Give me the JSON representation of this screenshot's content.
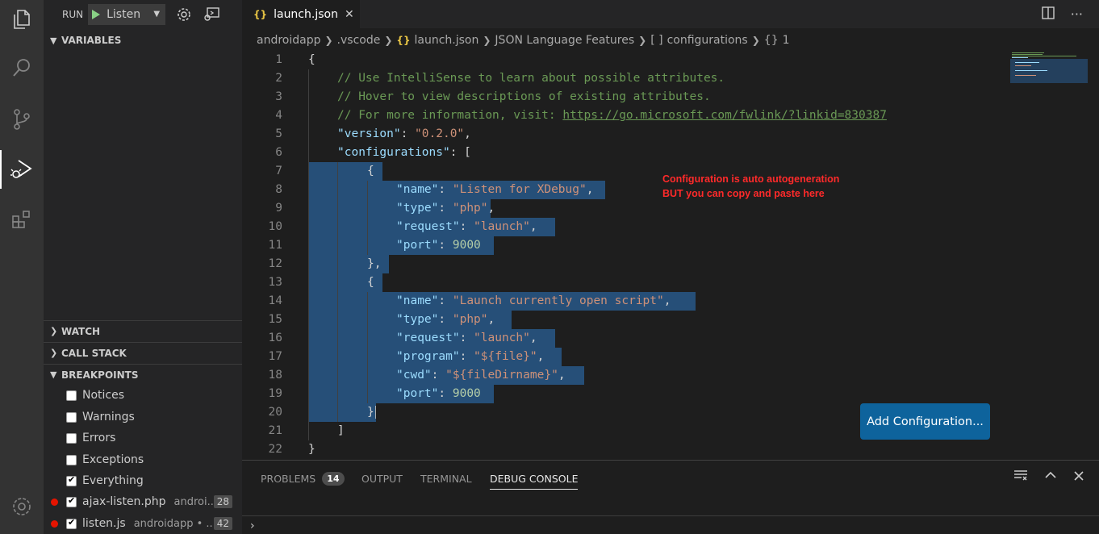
{
  "sidebar": {
    "run_label": "RUN",
    "config_name": "Listen",
    "sections": {
      "variables": "VARIABLES",
      "watch": "WATCH",
      "call_stack": "CALL STACK",
      "breakpoints": "BREAKPOINTS"
    },
    "breakpoints": [
      {
        "label": "Notices",
        "checked": false
      },
      {
        "label": "Warnings",
        "checked": false
      },
      {
        "label": "Errors",
        "checked": false
      },
      {
        "label": "Exceptions",
        "checked": false
      },
      {
        "label": "Everything",
        "checked": true
      }
    ],
    "files": [
      {
        "name": "ajax-listen.php",
        "path": "androi...",
        "line": "28"
      },
      {
        "name": "listen.js",
        "path": "androidapp • ...",
        "line": "42"
      }
    ]
  },
  "editor": {
    "tab_title": "launch.json",
    "breadcrumb": [
      "androidapp",
      ".vscode",
      "launch.json",
      "JSON Language Features",
      "configurations",
      "1"
    ],
    "line_numbers": [
      "1",
      "2",
      "3",
      "4",
      "5",
      "6",
      "7",
      "8",
      "9",
      "10",
      "11",
      "12",
      "13",
      "14",
      "15",
      "16",
      "17",
      "18",
      "19",
      "20",
      "21",
      "22"
    ],
    "code": {
      "l1": "{",
      "l2": "// Use IntelliSense to learn about possible attributes.",
      "l3": "// Hover to view descriptions of existing attributes.",
      "l4a": "// For more information, visit: ",
      "l4b": "https://go.microsoft.com/fwlink/?linkid=830387",
      "l5k": "\"version\"",
      "l5v": "\"0.2.0\"",
      "l6k": "\"configurations\"",
      "l6v": "[",
      "open_brace": "{",
      "close_brace_comma": "},",
      "close_brace": "}",
      "name1_v": "\"Listen for XDebug\"",
      "k_name": "\"name\"",
      "k_type": "\"type\"",
      "k_request": "\"request\"",
      "k_port": "\"port\"",
      "k_program": "\"program\"",
      "k_cwd": "\"cwd\"",
      "v_php": "\"php\"",
      "v_launch": "\"launch\"",
      "v_port": "9000",
      "name2_v": "\"Launch currently open script\"",
      "v_program": "\"${file}\"",
      "v_cwd": "\"${fileDirname}\"",
      "close_bracket": "]",
      "close_root": "}"
    },
    "annotation": "Configuration is auto autogeneration BUT you can copy and paste here",
    "add_config_label": "Add Configuration..."
  },
  "panel": {
    "tabs": [
      "PROBLEMS",
      "OUTPUT",
      "TERMINAL",
      "DEBUG CONSOLE"
    ],
    "problems_count": "14",
    "prompt": "›"
  },
  "colors": {
    "accent": "#0e639c",
    "selection": "#264f78",
    "breakpoint": "#e51400",
    "annotation": "#ff2a2a"
  }
}
